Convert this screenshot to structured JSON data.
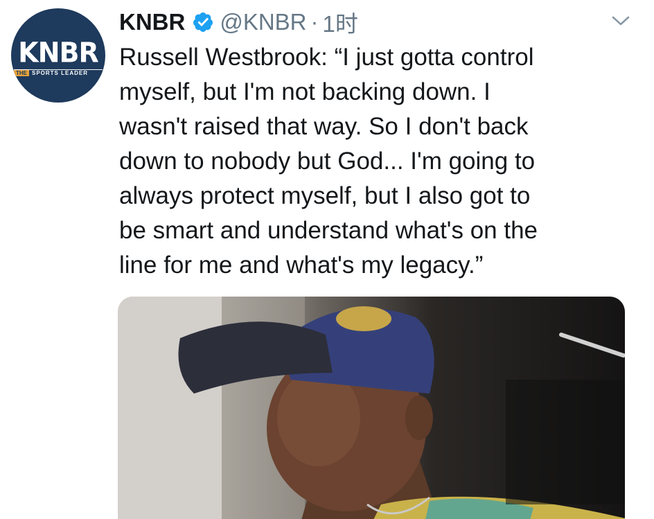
{
  "account": {
    "avatar_logo": "KNBR",
    "avatar_tag_the": "THE",
    "avatar_tagline": "SPORTS LEADER",
    "name": "KNBR",
    "verified": true,
    "handle": "@KNBR",
    "separator": "·",
    "timestamp": "1时"
  },
  "tweet": {
    "text": "Russell Westbrook: “I just gotta control\nmyself, but I'm not backing down. I\nwasn't raised that way. So I don't back\ndown to nobody but God... I'm going to\nalways protect myself, but I also got to\nbe smart and understand what's on the\nline for me and what's my legacy.”"
  },
  "media": {
    "type": "video-still"
  },
  "icons": {
    "verified": "verified-badge-icon",
    "more": "chevron-down-icon"
  },
  "colors": {
    "text": "#14171a",
    "secondary": "#657786",
    "verified": "#1da1f2",
    "avatar_bg": "#1e3a5c"
  }
}
